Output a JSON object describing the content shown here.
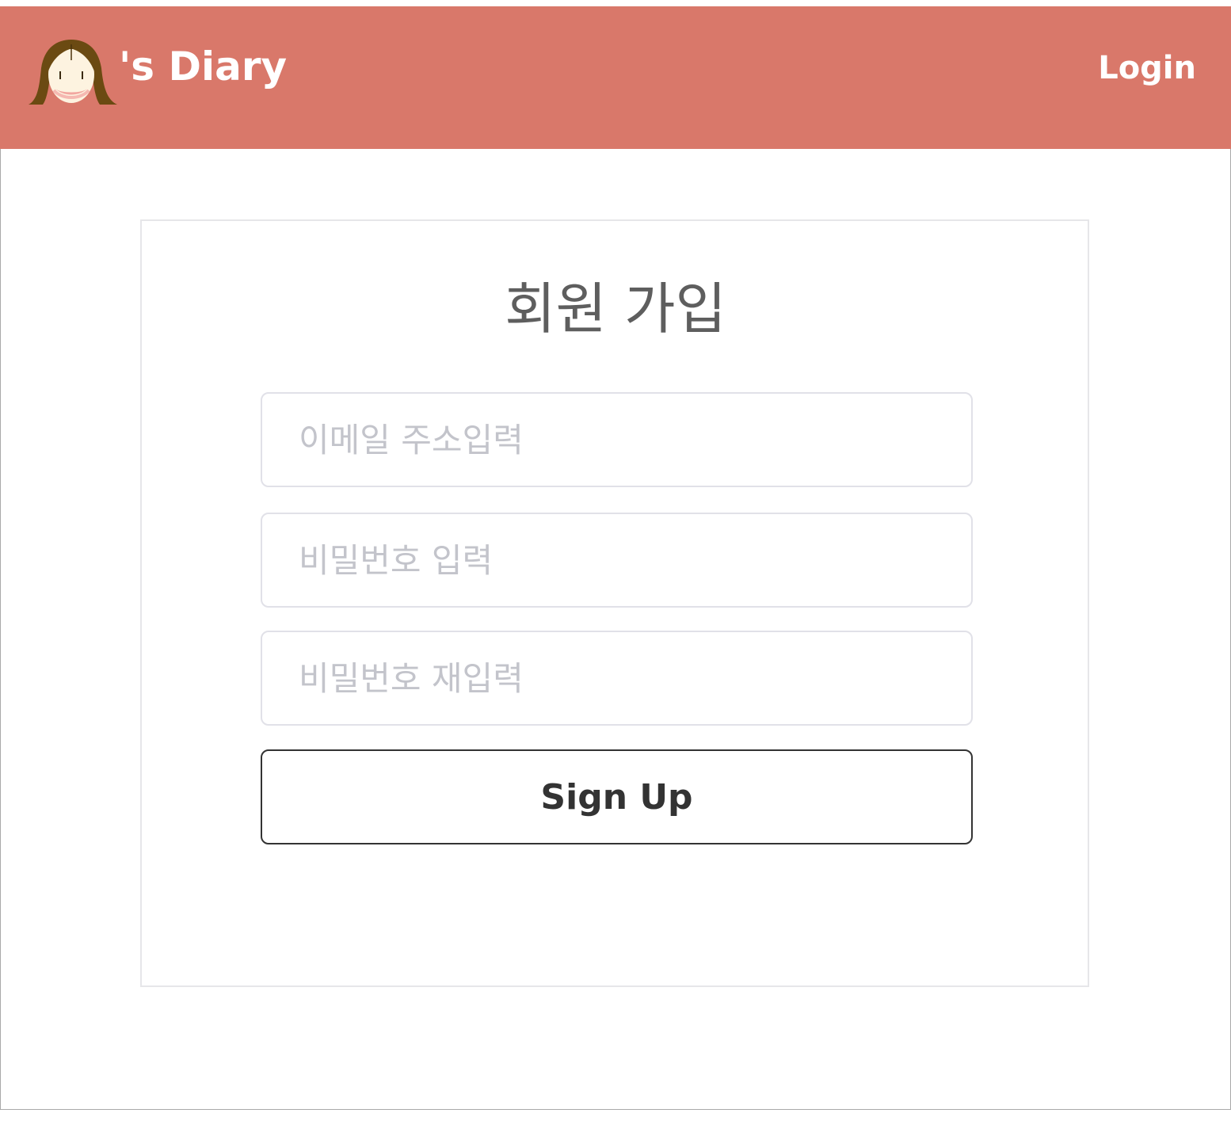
{
  "header": {
    "brand_text": "'s Diary",
    "login_label": "Login",
    "background_color": "#d9786a",
    "logo_icon": "girl-face-logo-icon"
  },
  "signup": {
    "title": "회원 가입",
    "email_placeholder": "이메일 주소입력",
    "password_placeholder": "비밀번호 입력",
    "password_confirm_placeholder": "비밀번호 재입력",
    "submit_label": "Sign Up"
  }
}
